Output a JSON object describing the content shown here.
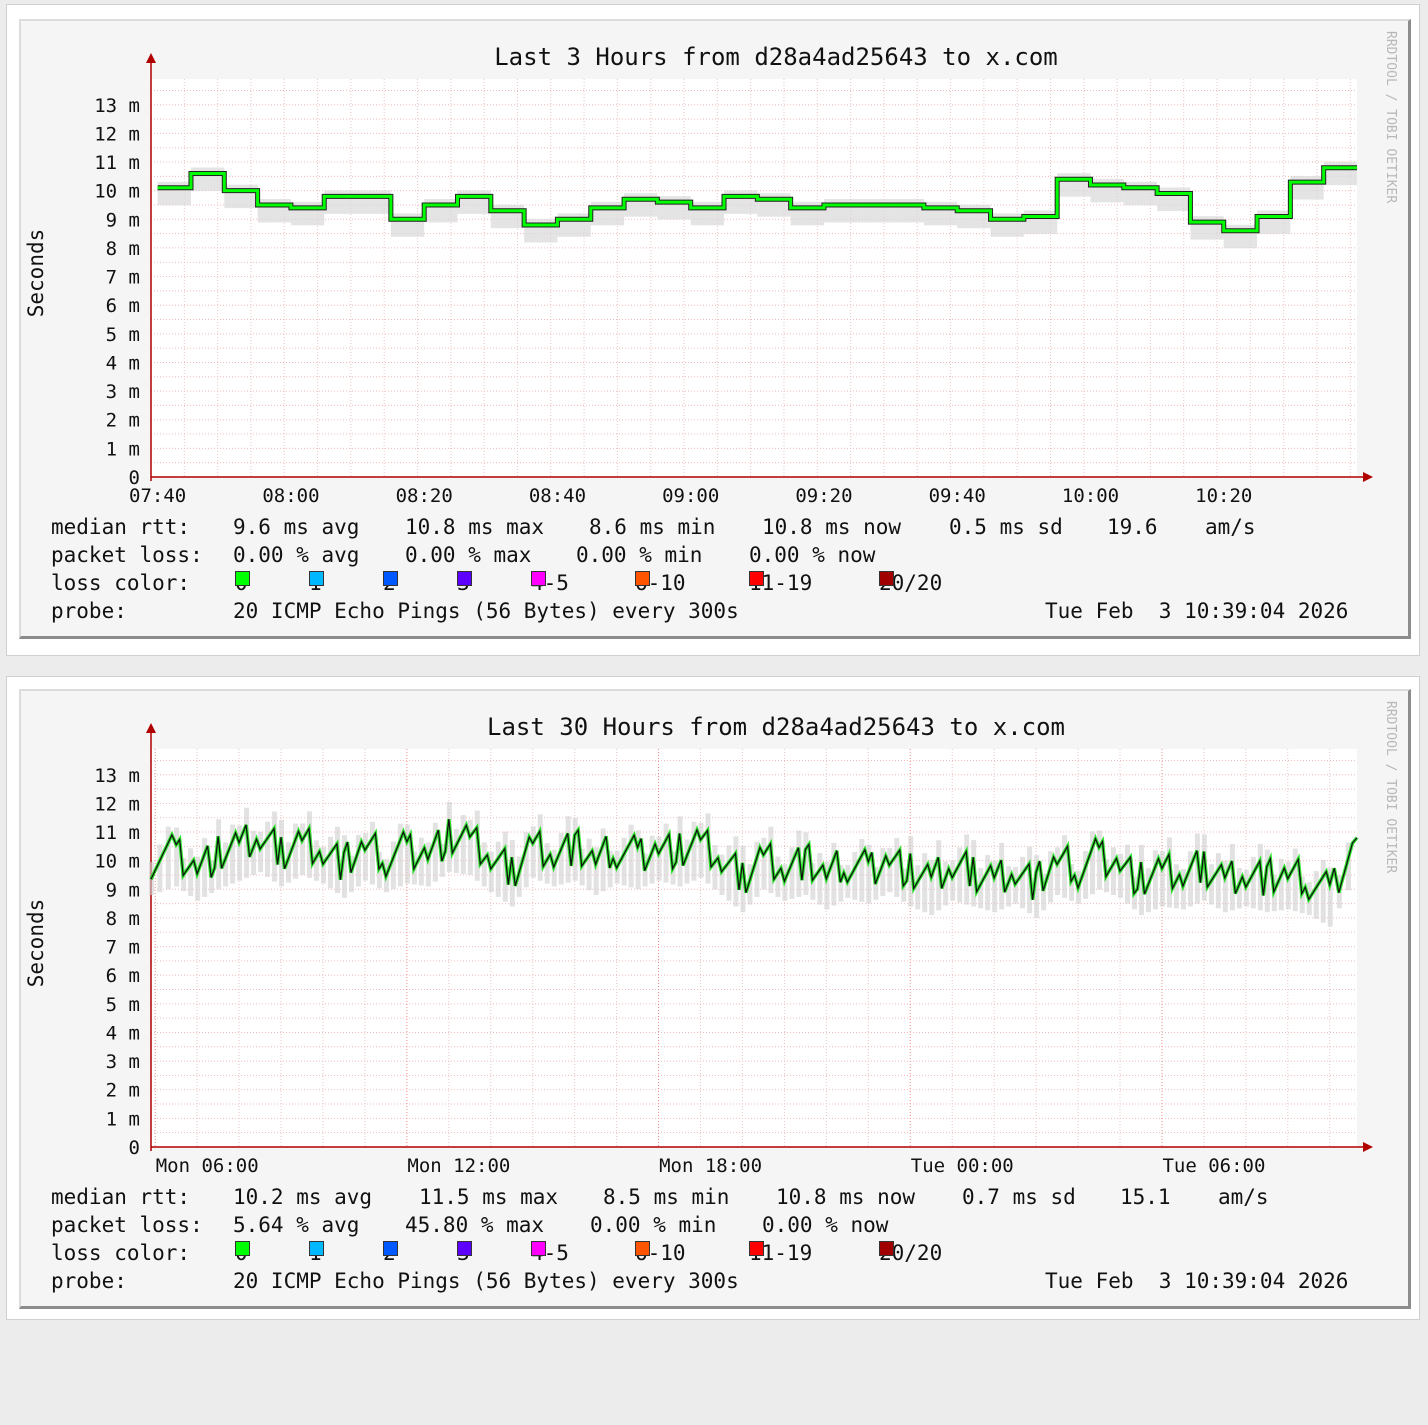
{
  "watermark": "RRDTOOL / TOBI OETIKER",
  "loss_color_keys": [
    {
      "label": "0",
      "color": "#00ff00"
    },
    {
      "label": "1",
      "color": "#00b8ff"
    },
    {
      "label": "2",
      "color": "#0059ff"
    },
    {
      "label": "3",
      "color": "#5e00ff"
    },
    {
      "label": "4-5",
      "color": "#ff00ff"
    },
    {
      "label": "6-10",
      "color": "#ff5500"
    },
    {
      "label": "11-19",
      "color": "#ff0000"
    },
    {
      "label": "20/20",
      "color": "#a10000"
    }
  ],
  "panels": [
    {
      "legend": {
        "rtt_label": "median rtt:",
        "rtt_values": [
          "9.6 ms avg",
          "10.8 ms max",
          "8.6 ms min",
          "10.8 ms now",
          "0.5 ms sd",
          "19.6",
          "am/s"
        ],
        "loss_label": "packet loss:",
        "loss_values": [
          "0.00 % avg",
          "0.00 % max",
          "0.00 % min",
          "0.00 % now"
        ],
        "color_label": "loss color:",
        "probe_label": "probe:",
        "probe_text": "20 ICMP Echo Pings (56 Bytes) every 300s",
        "timestamp": "Tue Feb  3 10:39:04 2026"
      }
    },
    {
      "legend": {
        "rtt_label": "median rtt:",
        "rtt_values": [
          "10.2 ms avg",
          "11.5 ms max",
          "8.5 ms min",
          "10.8 ms now",
          "0.7 ms sd",
          "15.1",
          "am/s"
        ],
        "loss_label": "packet loss:",
        "loss_values": [
          "5.64 % avg",
          "45.80 % max",
          "0.00 % min",
          "0.00 % now"
        ],
        "color_label": "loss color:",
        "probe_label": "probe:",
        "probe_text": "20 ICMP Echo Pings (56 Bytes) every 300s",
        "timestamp": "Tue Feb  3 10:39:04 2026"
      }
    }
  ],
  "chart_data": [
    {
      "type": "line",
      "title": "Last 3 Hours from d28a4ad25643 to x.com",
      "ylabel": "Seconds",
      "ylim": [
        0,
        0.0139
      ],
      "y_tick_values": [
        0,
        0.001,
        0.002,
        0.003,
        0.004,
        0.005,
        0.006,
        0.007,
        0.008,
        0.009,
        0.01,
        0.011,
        0.012,
        0.013
      ],
      "y_tick_labels": [
        "0",
        "1 m",
        "2 m",
        "3 m",
        "4 m",
        "5 m",
        "6 m",
        "7 m",
        "8 m",
        "9 m",
        "10 m",
        "11 m",
        "12 m",
        "13 m"
      ],
      "x_tick_labels": [
        "07:40",
        "08:00",
        "08:20",
        "08:40",
        "09:00",
        "09:20",
        "09:40",
        "10:00",
        "10:20"
      ],
      "xlim_minutes": [
        459,
        640
      ],
      "x_tick_minutes": [
        460,
        480,
        500,
        520,
        540,
        560,
        580,
        600,
        620
      ],
      "grid": true,
      "series": [
        {
          "name": "0",
          "x_minutes": [
            460,
            465,
            470,
            475,
            480,
            485,
            490,
            495,
            500,
            505,
            510,
            515,
            520,
            525,
            530,
            535,
            540,
            545,
            550,
            555,
            560,
            565,
            570,
            575,
            580,
            585,
            590,
            595,
            600,
            605,
            610,
            615,
            620,
            625,
            630,
            635,
            640
          ],
          "values": [
            0.0101,
            0.0106,
            0.01,
            0.0095,
            0.0094,
            0.0098,
            0.0098,
            0.009,
            0.0095,
            0.0098,
            0.0093,
            0.0088,
            0.009,
            0.0094,
            0.0097,
            0.0096,
            0.0094,
            0.0098,
            0.0097,
            0.0094,
            0.0095,
            0.0095,
            0.0095,
            0.0094,
            0.0093,
            0.009,
            0.0091,
            0.0104,
            0.0102,
            0.0101,
            0.0099,
            0.0089,
            0.0086,
            0.0091,
            0.0103,
            0.0108,
            0.0108
          ]
        }
      ]
    },
    {
      "type": "line",
      "title": "Last 30 Hours from d28a4ad25643 to x.com",
      "ylabel": "Seconds",
      "ylim": [
        0,
        0.0139
      ],
      "y_tick_values": [
        0,
        0.001,
        0.002,
        0.003,
        0.004,
        0.005,
        0.006,
        0.007,
        0.008,
        0.009,
        0.01,
        0.011,
        0.012,
        0.013
      ],
      "y_tick_labels": [
        "0",
        "1 m",
        "2 m",
        "3 m",
        "4 m",
        "5 m",
        "6 m",
        "7 m",
        "8 m",
        "9 m",
        "10 m",
        "11 m",
        "12 m",
        "13 m"
      ],
      "x_tick_labels": [
        "Mon 06:00",
        "Mon 12:00",
        "Mon 18:00",
        "Tue 00:00",
        "Tue 06:00"
      ],
      "xlim_hours": [
        5.9,
        34.65
      ],
      "x_tick_hours": [
        6,
        12,
        18,
        24,
        30
      ],
      "grid": true,
      "series": [
        {
          "name": "0",
          "x_hours": [
            5.9,
            6.5,
            7.0,
            7.5,
            8.0,
            8.5,
            9.0,
            9.5,
            10.0,
            10.5,
            11.0,
            11.5,
            12.0,
            12.5,
            13.0,
            13.5,
            14.0,
            14.5,
            15.0,
            15.5,
            16.0,
            16.5,
            17.0,
            17.5,
            18.0,
            18.5,
            19.0,
            19.5,
            20.0,
            20.5,
            21.0,
            21.5,
            22.0,
            22.5,
            23.0,
            23.5,
            24.0,
            24.5,
            25.0,
            25.5,
            26.0,
            26.5,
            27.0,
            27.5,
            28.0,
            28.5,
            29.0,
            29.5,
            30.0,
            30.5,
            31.0,
            31.5,
            32.0,
            32.5,
            33.0,
            33.5,
            34.0,
            34.65
          ],
          "values": [
            0.01,
            0.0103,
            0.0098,
            0.0102,
            0.0105,
            0.0108,
            0.0103,
            0.0107,
            0.0104,
            0.0099,
            0.0105,
            0.0101,
            0.0104,
            0.0103,
            0.0108,
            0.0107,
            0.0101,
            0.0096,
            0.0106,
            0.0103,
            0.0105,
            0.01,
            0.0104,
            0.0102,
            0.0105,
            0.0103,
            0.0106,
            0.01,
            0.0094,
            0.0102,
            0.0098,
            0.01,
            0.0095,
            0.0099,
            0.0097,
            0.0101,
            0.0096,
            0.0093,
            0.0098,
            0.0096,
            0.0094,
            0.0097,
            0.0092,
            0.01,
            0.0097,
            0.0102,
            0.0099,
            0.0093,
            0.0096,
            0.0095,
            0.0098,
            0.0094,
            0.0096,
            0.0094,
            0.0095,
            0.0093,
            0.0089,
            0.0108
          ]
        }
      ]
    }
  ]
}
